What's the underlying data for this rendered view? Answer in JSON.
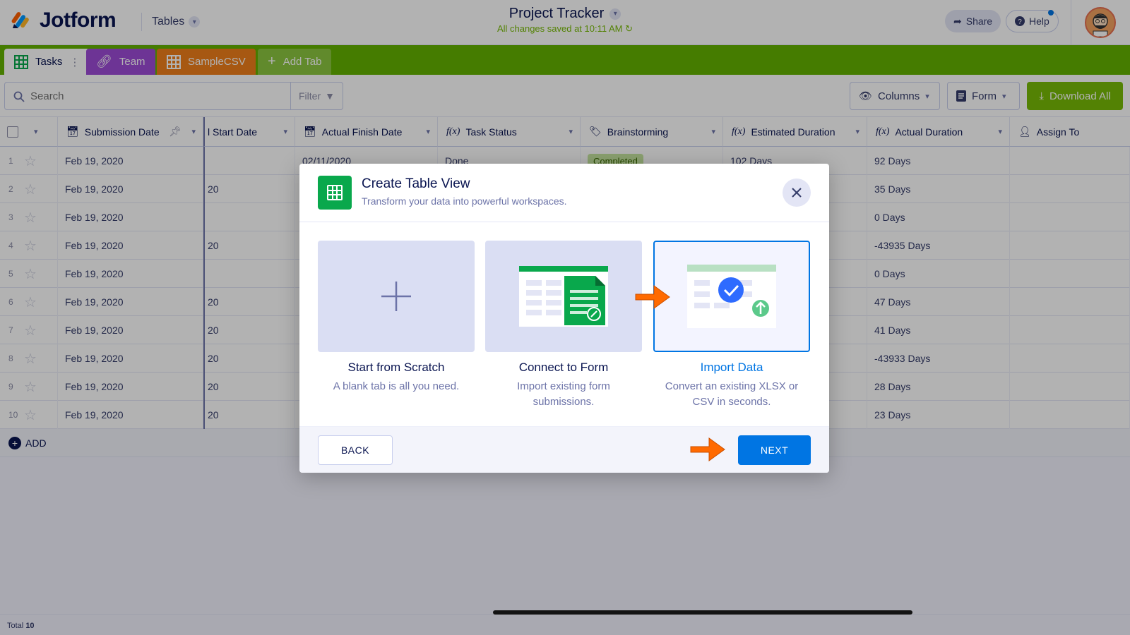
{
  "app": {
    "logo_text": "Jotform",
    "section": "Tables"
  },
  "header": {
    "title": "Project Tracker",
    "saved_status": "All changes saved at 10:11 AM",
    "share_label": "Share",
    "help_label": "Help"
  },
  "tabs": [
    {
      "label": "Tasks",
      "color": "#ffffff"
    },
    {
      "label": "Team",
      "color": "#9d4bd6"
    },
    {
      "label": "SampleCSV",
      "color": "#ef7f1a"
    },
    {
      "label": "Add Tab",
      "color": "#8cc63f"
    }
  ],
  "toolbar": {
    "search_placeholder": "Search",
    "filter_label": "Filter",
    "columns_label": "Columns",
    "form_label": "Form",
    "download_label": "Download All"
  },
  "table": {
    "columns": [
      "Submission Date",
      "l Start Date",
      "Actual Finish Date",
      "Task Status",
      "Brainstorming",
      "Estimated Duration",
      "Actual Duration",
      "Assign To"
    ],
    "rows": [
      {
        "num": "1",
        "date": "Feb 19, 2020",
        "start": "",
        "finish": "02/11/2020",
        "status": "Done",
        "brain": "Completed",
        "est": "102 Days",
        "actual": "92 Days"
      },
      {
        "num": "2",
        "date": "Feb 19, 2020",
        "start": "20",
        "finish": "",
        "status": "",
        "brain": "",
        "est": "",
        "actual": "35 Days"
      },
      {
        "num": "3",
        "date": "Feb 19, 2020",
        "start": "",
        "finish": "",
        "status": "",
        "brain": "",
        "est": "",
        "actual": "0 Days"
      },
      {
        "num": "4",
        "date": "Feb 19, 2020",
        "start": "20",
        "finish": "",
        "status": "",
        "brain": "",
        "est": "",
        "actual": "-43935 Days"
      },
      {
        "num": "5",
        "date": "Feb 19, 2020",
        "start": "",
        "finish": "",
        "status": "",
        "brain": "",
        "est": "",
        "actual": "0 Days"
      },
      {
        "num": "6",
        "date": "Feb 19, 2020",
        "start": "20",
        "finish": "",
        "status": "",
        "brain": "",
        "est": "",
        "actual": "47 Days"
      },
      {
        "num": "7",
        "date": "Feb 19, 2020",
        "start": "20",
        "finish": "",
        "status": "",
        "brain": "",
        "est": "",
        "actual": "41 Days"
      },
      {
        "num": "8",
        "date": "Feb 19, 2020",
        "start": "20",
        "finish": "",
        "status": "",
        "brain": "",
        "est": "",
        "actual": "-43933 Days"
      },
      {
        "num": "9",
        "date": "Feb 19, 2020",
        "start": "20",
        "finish": "",
        "status": "",
        "brain": "",
        "est": "",
        "actual": "28 Days"
      },
      {
        "num": "10",
        "date": "Feb 19, 2020",
        "start": "20",
        "finish": "",
        "status": "",
        "brain": "",
        "est": "",
        "actual": "23 Days"
      }
    ],
    "add_label": "ADD",
    "total_label": "Total",
    "total_count": "10"
  },
  "modal": {
    "title": "Create Table View",
    "subtitle": "Transform your data into powerful workspaces.",
    "options": [
      {
        "title": "Start from Scratch",
        "desc": "A blank tab is all you need."
      },
      {
        "title": "Connect to Form",
        "desc": "Import existing form submissions."
      },
      {
        "title": "Import Data",
        "desc": "Convert an existing XLSX or CSV in seconds."
      }
    ],
    "selected_option": "Import Data",
    "back_label": "BACK",
    "next_label": "NEXT"
  },
  "colors": {
    "brand_green": "#64b200",
    "primary_blue": "#0075e3",
    "annotation_arrow": "#ff6a00"
  }
}
